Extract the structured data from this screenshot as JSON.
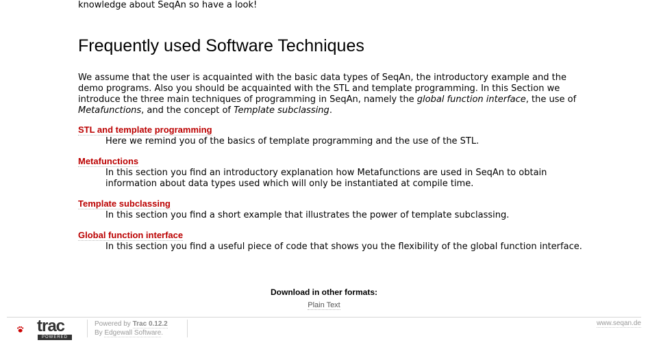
{
  "top_text": "knowledge about SeqAn so have a look!",
  "page_title": "Frequently used Software Techniques",
  "intro": {
    "p1": "We assume that the user is acquainted with the basic data types of SeqAn, the introductory example and the demo programs. Also you should be acquainted with the STL and template programming. In this Section we introduce the three main techniques of programming in SeqAn, namely the ",
    "em1": "global function interface",
    "p2": ", the use of ",
    "em2": "Metafunctions",
    "p3": ", and the concept of ",
    "em3": "Template subclassing",
    "p4": "."
  },
  "sections": [
    {
      "title": "STL and template programming",
      "desc": "Here we remind you of the basics of template programming and the use of the STL."
    },
    {
      "title": "Metafunctions",
      "desc": "In this section you find an introductory explanation how Metafunctions are used in SeqAn to obtain information about data types used which will only be instantiated at compile time."
    },
    {
      "title": "Template subclassing",
      "desc": "In this section you find a short example that illustrates the power of template subclassing."
    },
    {
      "title": "Global function interface",
      "desc": "In this section you find a useful piece of code that shows you the flexibility of the global function interface."
    }
  ],
  "downloads": {
    "heading": "Download in other formats:",
    "plain_text": "Plain Text"
  },
  "footer": {
    "logo_word": "trac",
    "logo_badge": "POWERED",
    "powered_prefix": "Powered by ",
    "trac_version": "Trac 0.12.2",
    "by_prefix": "By ",
    "edgewall": "Edgewall Software",
    "by_suffix": ".",
    "site": "www.seqan.de"
  },
  "colors": {
    "link": "#bb0000",
    "rule": "#d7d7d7",
    "muted": "#999999"
  }
}
